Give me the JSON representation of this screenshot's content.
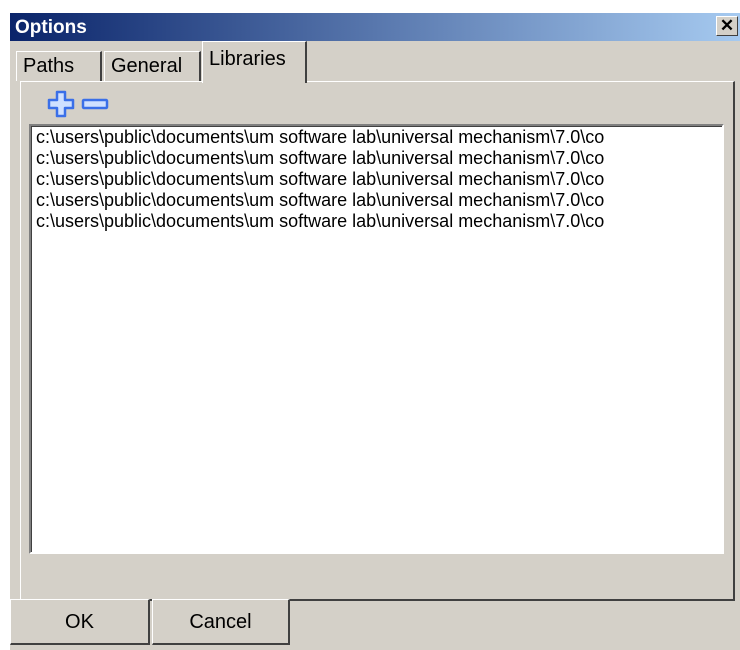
{
  "window": {
    "title": "Options",
    "close_symbol": "✕"
  },
  "tabs": [
    {
      "label": "Paths",
      "active": false
    },
    {
      "label": "General",
      "active": false
    },
    {
      "label": "Libraries",
      "active": true
    }
  ],
  "toolbar": {
    "add_icon": "plus-icon",
    "remove_icon": "minus-icon",
    "icon_color": "#3a6fe8"
  },
  "libraries": {
    "items": [
      "c:\\users\\public\\documents\\um software lab\\universal mechanism\\7.0\\co",
      "c:\\users\\public\\documents\\um software lab\\universal mechanism\\7.0\\co",
      "c:\\users\\public\\documents\\um software lab\\universal mechanism\\7.0\\co",
      "c:\\users\\public\\documents\\um software lab\\universal mechanism\\7.0\\co",
      "c:\\users\\public\\documents\\um software lab\\universal mechanism\\7.0\\co"
    ]
  },
  "buttons": {
    "ok": "OK",
    "cancel": "Cancel"
  }
}
